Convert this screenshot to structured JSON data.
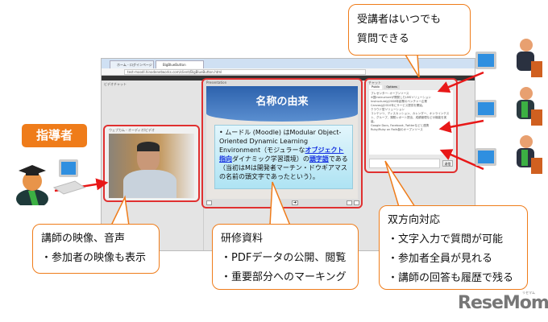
{
  "browser": {
    "tabs": [
      "ホーム - ログインページ",
      "BigBlueButton"
    ],
    "url": "test-moodl.hinodenetworks.com/client/BigBlueButton.html",
    "video_panel_title": "ビデオチャット",
    "video_window_title": "ウェブカム - オーディオ/ビデオ",
    "presentation_title": "Presentation",
    "chat_title": "チャット",
    "chat_tabs": [
      "Public",
      "Options"
    ],
    "chat_lines": [
      "プレゼンター: オープンソース",
      "※国Instructureが開発したLMSソリューション",
      "",
      "Instructureは2008年創業のベンチャー企業",
      "Canvasは2010年にサービス提供を開始。",
      "クラウド型ソリューション",
      "コンテンツ、ディスカッション、カレンダー、オンラインテスト、グループ、課題レポート提出、成績管理などの機能を実装。",
      "Google Docs, Facebook, Twitterなどと連携",
      "Ruby/Ruby on Rails製のオープンソース"
    ],
    "send_label": "送信"
  },
  "slide": {
    "heading": "名称の由来",
    "text_parts": [
      "ムードル (Moodle) はModular Object-Oriented Dynamic Learning Environment（モジュラーな",
      "オブジェクト指向",
      "ダイナミック学習環境）の",
      "頭字語",
      "である（当初はMは開発者マーチン・ドウギアマスの名前の頭文字であったという）。"
    ]
  },
  "instructor_label": "指導者",
  "callouts": {
    "learners": [
      "受講者はいつでも",
      "質問できる"
    ],
    "video": [
      "講師の映像、音声",
      "・参加者の映像も表示"
    ],
    "materials": [
      "研修資料",
      "・PDFデータの公開、閲覧",
      "・重要部分へのマーキング"
    ],
    "interactive": [
      "双方向対応",
      "・文字入力で質問が可能",
      "・参加者全員が見れる",
      "・講師の回答も履歴で残る"
    ]
  },
  "logo": {
    "text": "ReseMom",
    "ruby": "リセマム"
  },
  "colors": {
    "accent": "#ef7c1a",
    "highlight": "#e03030",
    "slide_blue": "#2d62ad"
  }
}
